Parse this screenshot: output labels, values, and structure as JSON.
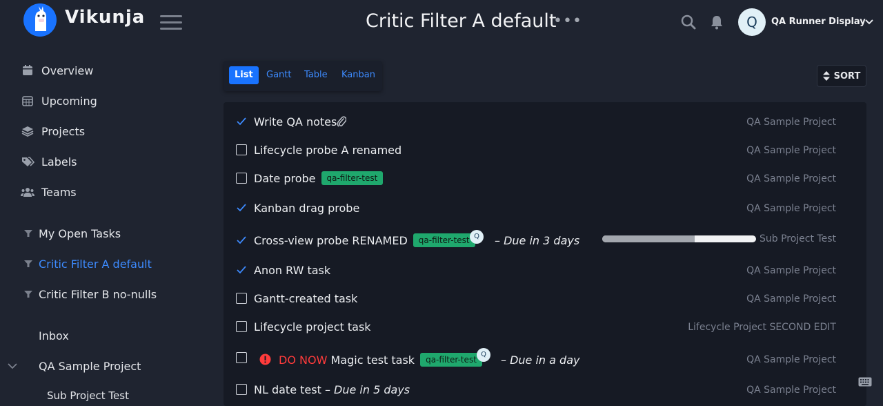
{
  "app": {
    "brand": "Vikunja",
    "page_title": "Critic Filter A default",
    "title_menu": "•••",
    "user": {
      "initial": "Q",
      "name": "QA Runner Display"
    }
  },
  "sidebar": {
    "main": [
      {
        "label": "Overview",
        "icon": "calendar-icon"
      },
      {
        "label": "Upcoming",
        "icon": "calendar-grid-icon"
      },
      {
        "label": "Projects",
        "icon": "layers-icon"
      },
      {
        "label": "Labels",
        "icon": "tags-icon"
      },
      {
        "label": "Teams",
        "icon": "users-icon"
      }
    ],
    "filters": [
      {
        "label": "My Open Tasks",
        "icon": "filter-icon"
      },
      {
        "label": "Critic Filter A default",
        "icon": "filter-icon",
        "active": true
      },
      {
        "label": "Critic Filter B no-nulls",
        "icon": "filter-icon"
      }
    ],
    "projects": [
      {
        "label": "Inbox"
      },
      {
        "label": "QA Sample Project",
        "expandable": true
      },
      {
        "label": "Sub Project Test"
      }
    ]
  },
  "views": {
    "tabs": [
      "List",
      "Gantt",
      "Table",
      "Kanban"
    ],
    "active": "List",
    "sort_label": "SORT"
  },
  "tasks": [
    {
      "title": "Write QA notes",
      "done": true,
      "attachment": true,
      "project": "QA Sample Project"
    },
    {
      "title": "Lifecycle probe A renamed",
      "done": false,
      "project": "QA Sample Project"
    },
    {
      "title": "Date probe",
      "done": false,
      "label": "qa-filter-test",
      "project": "QA Sample Project"
    },
    {
      "title": "Kanban drag probe",
      "done": true,
      "project": "QA Sample Project"
    },
    {
      "title": "Cross-view probe RENAMED",
      "done": true,
      "label": "qa-filter-test",
      "assignee": "Q",
      "due": "– Due in 3 days",
      "progress": 0.6,
      "project": "Sub Project Test"
    },
    {
      "title": "Anon RW task",
      "done": true,
      "project": "QA Sample Project"
    },
    {
      "title": "Gantt-created task",
      "done": false,
      "project": "QA Sample Project"
    },
    {
      "title": "Lifecycle project task",
      "done": false,
      "project": "Lifecycle Project SECOND EDIT"
    },
    {
      "title": "Magic test task",
      "done": false,
      "priority": "DO NOW",
      "label": "qa-filter-test",
      "assignee": "Q",
      "due": "– Due in a day",
      "project": "QA Sample Project"
    },
    {
      "title": "NL date test",
      "done": false,
      "due": "– Due in 5 days",
      "project": "QA Sample Project"
    }
  ],
  "colors": {
    "background": "#1f2430",
    "panel": "#161a24",
    "accent": "#1973ff",
    "label": "#1fa86d",
    "priority": "#ff3b3b"
  }
}
